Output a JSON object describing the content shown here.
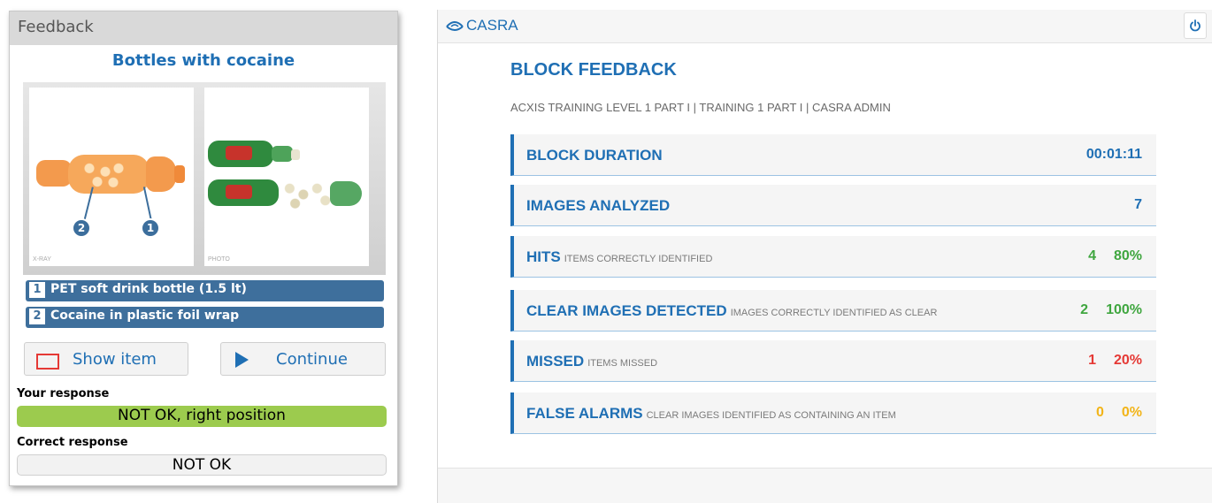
{
  "feedback": {
    "header": "Feedback",
    "title": "Bottles with cocaine",
    "image_labels": {
      "xray": "X-RAY",
      "photo": "PHOTO"
    },
    "markers": [
      "2",
      "1"
    ],
    "items": [
      {
        "num": "1",
        "label": "PET soft drink bottle (1.5 lt)"
      },
      {
        "num": "2",
        "label": "Cocaine in plastic foil wrap"
      }
    ],
    "show_item_label": "Show item",
    "continue_label": "Continue",
    "your_response_label": "Your response",
    "your_response_value": "NOT OK, right position",
    "correct_response_label": "Correct response",
    "correct_response_value": "NOT OK"
  },
  "casra": {
    "logo_text": "CASRA",
    "title": "BLOCK FEEDBACK",
    "subtitle": "ACXIS TRAINING LEVEL 1 PART I | TRAINING 1 PART I | CASRA ADMIN",
    "metrics": [
      {
        "name": "BLOCK DURATION",
        "desc": "",
        "value": "00:01:11",
        "percent": "",
        "color": "#1f6fb4"
      },
      {
        "name": "IMAGES ANALYZED",
        "desc": "",
        "value": "7",
        "percent": "",
        "color": "#1f6fb4"
      },
      {
        "name": "HITS",
        "desc": "ITEMS CORRECTLY IDENTIFIED",
        "value": "4",
        "percent": "80%",
        "color": "#3fa63f"
      },
      {
        "name": "CLEAR IMAGES DETECTED",
        "desc": "IMAGES CORRECTLY IDENTIFIED AS CLEAR",
        "value": "2",
        "percent": "100%",
        "color": "#3fa63f"
      },
      {
        "name": "MISSED",
        "desc": "ITEMS MISSED",
        "value": "1",
        "percent": "20%",
        "color": "#e53935"
      },
      {
        "name": "FALSE ALARMS",
        "desc": "CLEAR IMAGES IDENTIFIED AS CONTAINING AN ITEM",
        "value": "0",
        "percent": "0%",
        "color": "#f2b418"
      }
    ]
  },
  "colors": {
    "accent": "#1f6fb4",
    "item_bar": "#3e6f9c",
    "response_ok": "#9ccb4e",
    "success": "#3fa63f",
    "error": "#e53935",
    "warning": "#f2b418"
  },
  "icons": {
    "show_item": "red-square-icon",
    "continue": "play-icon",
    "power": "power-icon",
    "logo": "casra-logo-icon"
  }
}
